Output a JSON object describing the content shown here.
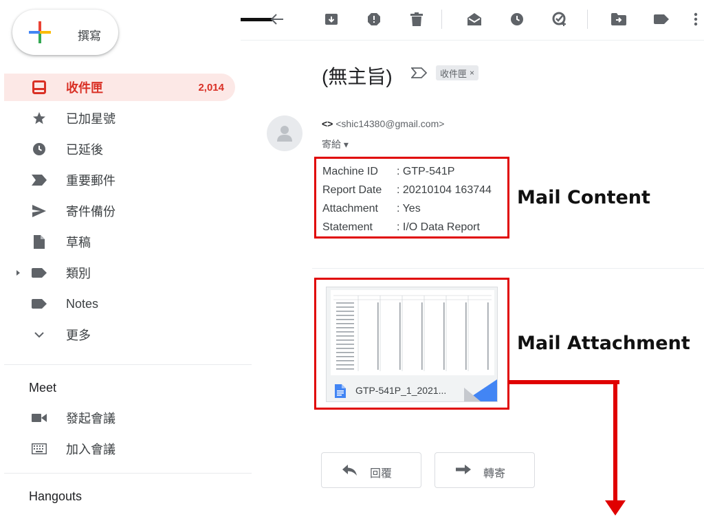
{
  "sidebar": {
    "compose_label": "撰寫",
    "items": [
      {
        "label": "收件匣",
        "count": "2,014",
        "icon": "inbox-icon"
      },
      {
        "label": "已加星號",
        "icon": "star-icon"
      },
      {
        "label": "已延後",
        "icon": "clock-icon"
      },
      {
        "label": "重要郵件",
        "icon": "important-icon"
      },
      {
        "label": "寄件備份",
        "icon": "send-icon"
      },
      {
        "label": "草稿",
        "icon": "draft-icon"
      },
      {
        "label": "類別",
        "icon": "label-icon"
      },
      {
        "label": "Notes",
        "icon": "label-icon"
      },
      {
        "label": "更多",
        "icon": "chevron-down-icon"
      }
    ],
    "meet": {
      "title": "Meet",
      "items": [
        {
          "label": "發起會議",
          "icon": "video-icon"
        },
        {
          "label": "加入會議",
          "icon": "keyboard-icon"
        }
      ]
    },
    "hangouts_title": "Hangouts"
  },
  "toolbar": {
    "icons": [
      "back-arrow-icon",
      "archive-icon",
      "report-spam-icon",
      "delete-icon",
      "mark-unread-icon",
      "snooze-icon",
      "add-task-icon",
      "move-to-icon",
      "labels-icon",
      "more-vert-icon"
    ]
  },
  "message": {
    "subject": "(無主旨)",
    "label_chip": "收件匣",
    "label_chip_close": "×",
    "sender_name": "<>",
    "sender_email": "<shic14380@gmail.com>",
    "to_line": "寄給 ▾",
    "content": [
      {
        "key": "Machine ID",
        "value": ": GTP-541P"
      },
      {
        "key": "Report Date",
        "value": ": 20210104 163744"
      },
      {
        "key": "Attachment",
        "value": ": Yes"
      },
      {
        "key": "Statement",
        "value": ": I/O Data Report"
      }
    ],
    "attachment": {
      "filename": "GTP-541P_1_2021..."
    },
    "reply_label": "回覆",
    "forward_label": "轉寄"
  },
  "annotations": {
    "content_label": "Mail Content",
    "attachment_label": "Mail Attachment"
  },
  "colors": {
    "accent_red": "#d93025",
    "highlight_box": "#e00000",
    "active_bg": "#fce8e6",
    "doc_blue": "#4285f4"
  }
}
